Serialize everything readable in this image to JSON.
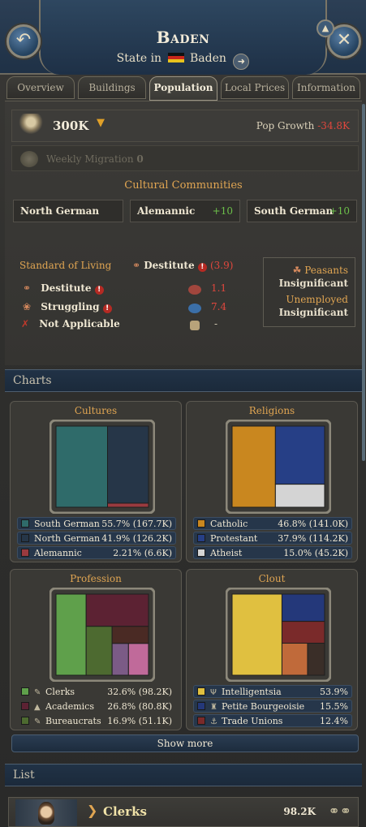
{
  "header": {
    "title": "Baden",
    "subtitle_prefix": "State in",
    "subtitle_country": "Baden",
    "back_icon": "undo-arrow-icon",
    "close_icon": "close-icon",
    "pin_icon": "pin-icon"
  },
  "tabs": [
    {
      "label": "Overview",
      "active": false
    },
    {
      "label": "Buildings",
      "active": false
    },
    {
      "label": "Population",
      "active": true
    },
    {
      "label": "Local Prices",
      "active": false
    },
    {
      "label": "Information",
      "active": false
    }
  ],
  "population": {
    "total": "300K",
    "growth_label": "Pop Growth",
    "growth_value": "-34.8K",
    "migration_label": "Weekly Migration",
    "migration_value": "0"
  },
  "cultural": {
    "label": "Cultural Communities",
    "items": [
      {
        "name": "North German",
        "change": ""
      },
      {
        "name": "Alemannic",
        "change": "+10"
      },
      {
        "name": "South German",
        "change": "+10"
      }
    ]
  },
  "standard_of_living": {
    "label": "Standard of Living",
    "level": "Destitute",
    "score": "(3.9)",
    "rows": [
      {
        "name": "Destitute",
        "value": "1.1",
        "icon": "bowl-icon"
      },
      {
        "name": "Struggling",
        "value": "7.4",
        "icon": "wheat-icon"
      },
      {
        "name": "Not Applicable",
        "value": "-",
        "icon": "cross-icon"
      }
    ],
    "peasants_label": "Peasants",
    "peasants_value": "Insignificant",
    "unemployed_label": "Unemployed",
    "unemployed_value": "Insignificant"
  },
  "charts_header": "Charts",
  "list_header": "List",
  "show_more": "Show more",
  "chart_data": [
    {
      "type": "table",
      "title": "Cultures",
      "rows": [
        {
          "name": "South German",
          "pct": "55.7%",
          "value": "(167.7K)",
          "color": "#2f6b6a"
        },
        {
          "name": "North German",
          "pct": "41.9%",
          "value": "(126.2K)",
          "color": "#263648"
        },
        {
          "name": "Alemannic",
          "pct": "2.21%",
          "value": "(6.6K)",
          "color": "#9a3a3f"
        }
      ]
    },
    {
      "type": "table",
      "title": "Religions",
      "rows": [
        {
          "name": "Catholic",
          "pct": "46.8%",
          "value": "(141.0K)",
          "color": "#c9871f"
        },
        {
          "name": "Protestant",
          "pct": "37.9%",
          "value": "(114.2K)",
          "color": "#263f86"
        },
        {
          "name": "Atheist",
          "pct": "15.0%",
          "value": "(45.2K)",
          "color": "#d4d4d4"
        }
      ]
    },
    {
      "type": "table",
      "title": "Profession",
      "rows": [
        {
          "name": "Clerks",
          "pct": "32.6%",
          "value": "(98.2K)",
          "color": "#5fa04b",
          "icon": "clerk-icon"
        },
        {
          "name": "Academics",
          "pct": "26.8%",
          "value": "(80.8K)",
          "color": "#5c2233",
          "icon": "academic-icon"
        },
        {
          "name": "Bureaucrats",
          "pct": "16.9%",
          "value": "(51.1K)",
          "color": "#4d6a30",
          "icon": "bureaucrat-icon"
        }
      ]
    },
    {
      "type": "table",
      "title": "Clout",
      "rows": [
        {
          "name": "Intelligentsia",
          "pct": "53.9%",
          "value": "",
          "color": "#e0c040",
          "icon": "lamp-icon"
        },
        {
          "name": "Petite Bourgeoisie",
          "pct": "15.5%",
          "value": "",
          "color": "#24387a",
          "icon": "shop-icon"
        },
        {
          "name": "Trade Unions",
          "pct": "12.4%",
          "value": "",
          "color": "#7a2a2a",
          "icon": "union-icon"
        }
      ]
    }
  ],
  "list": [
    {
      "name": "Clerks",
      "value": "98.2K"
    }
  ]
}
